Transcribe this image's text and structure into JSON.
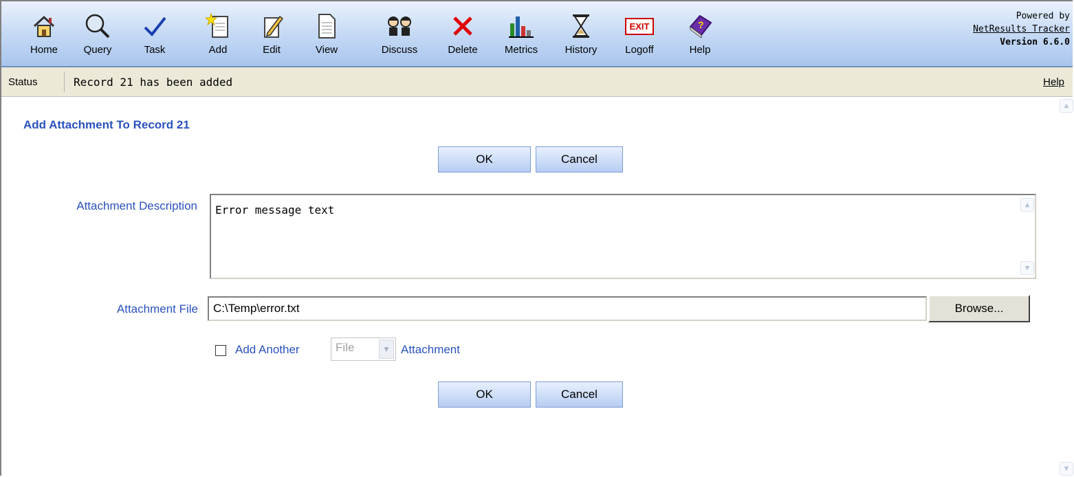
{
  "toolbar": {
    "items": [
      {
        "label": "Home",
        "icon": "home-icon"
      },
      {
        "label": "Query",
        "icon": "magnifier-icon"
      },
      {
        "label": "Task",
        "icon": "checkmark-icon"
      },
      {
        "label": "Add",
        "icon": "new-document-icon"
      },
      {
        "label": "Edit",
        "icon": "pencil-icon"
      },
      {
        "label": "View",
        "icon": "document-icon"
      },
      {
        "label": "Discuss",
        "icon": "people-icon"
      },
      {
        "label": "Delete",
        "icon": "red-x-icon"
      },
      {
        "label": "Metrics",
        "icon": "bar-chart-icon"
      },
      {
        "label": "History",
        "icon": "hourglass-icon"
      },
      {
        "label": "Logoff",
        "icon": "exit-sign-icon"
      },
      {
        "label": "Help",
        "icon": "help-book-icon"
      }
    ],
    "exit_sign_text": "EXIT",
    "powered_by": "Powered by",
    "product_link": "NetResults Tracker",
    "version": "Version 6.6.0"
  },
  "status": {
    "label": "Status",
    "message": "Record 21 has been added",
    "help": "Help"
  },
  "form": {
    "heading": "Add Attachment To Record 21",
    "ok_label": "OK",
    "cancel_label": "Cancel",
    "description_label": "Attachment Description",
    "description_value": "Error message text",
    "file_label": "Attachment File",
    "file_value": "C:\\Temp\\error.txt",
    "browse_label": "Browse...",
    "add_another_prefix": "Add Another",
    "add_another_type": "File",
    "add_another_suffix": "Attachment"
  },
  "colors": {
    "accent": "#2a52be",
    "toolbar_top": "#eaf2fd",
    "toolbar_bottom": "#a9c5ee",
    "status_bg": "#ece9d8"
  }
}
